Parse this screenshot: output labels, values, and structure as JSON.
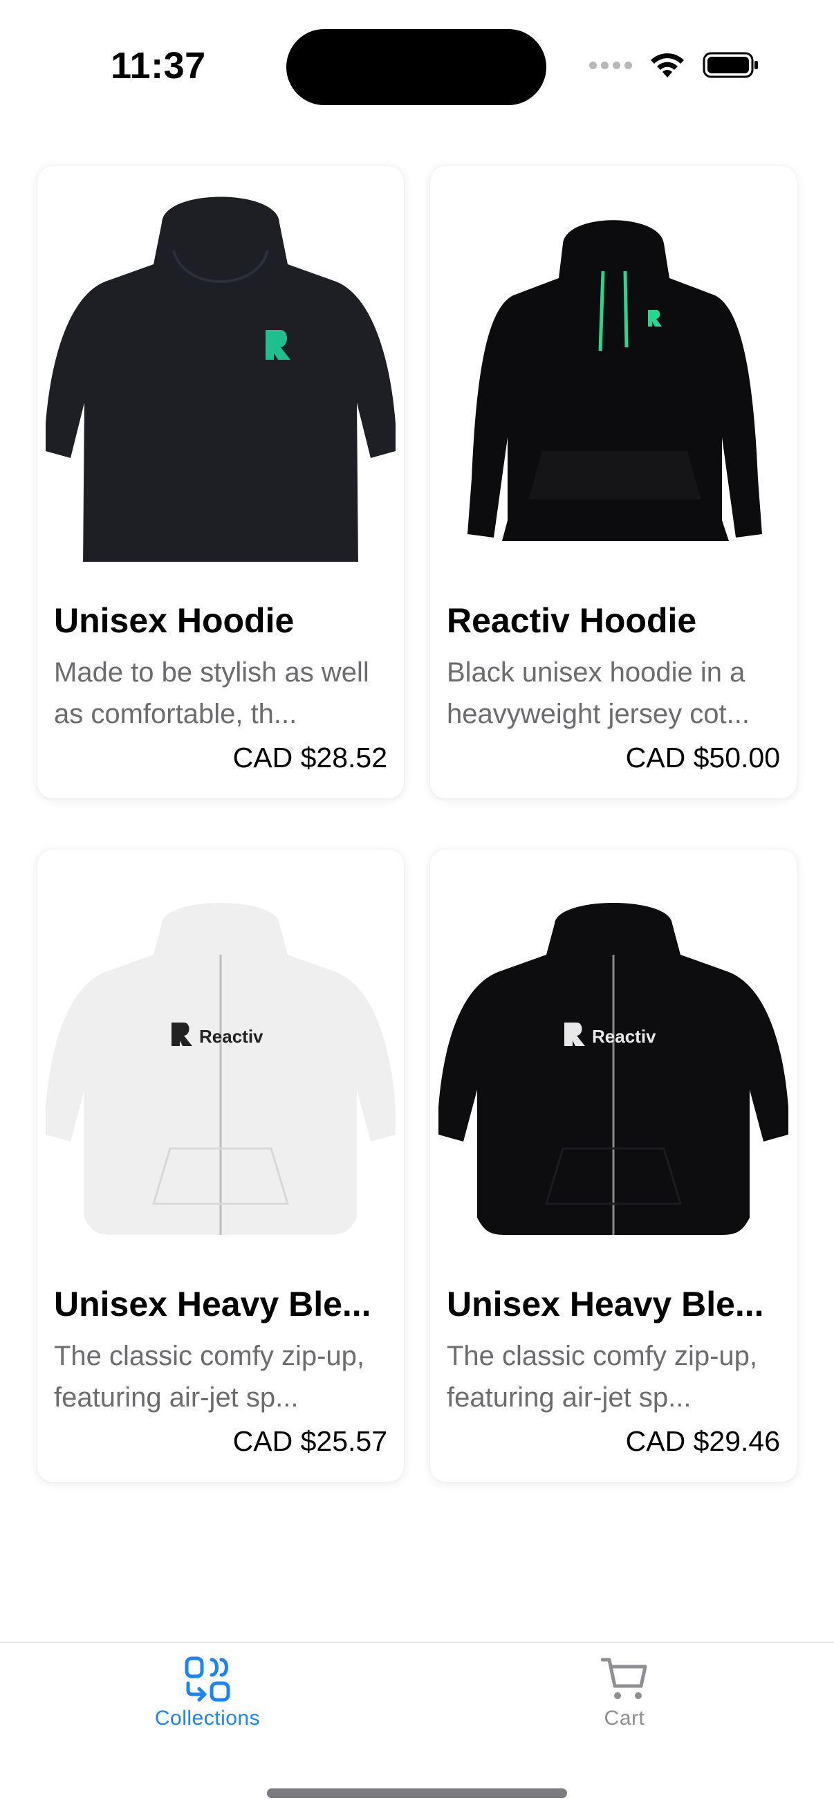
{
  "status_bar": {
    "time": "11:37",
    "icons": [
      "cellular-signal-icon",
      "wifi-icon",
      "battery-icon"
    ]
  },
  "products": [
    {
      "title": "Unisex Hoodie",
      "description": "Made to be stylish as well as comfortable, th...",
      "price": "CAD $28.52",
      "image": "hoodie-pullover-dark-navy"
    },
    {
      "title": "Reactiv Hoodie",
      "description": "Black unisex hoodie in a heavyweight jersey cot...",
      "price": "CAD $50.00",
      "image": "hoodie-pullover-black-green-drawstrings"
    },
    {
      "title": "Unisex Heavy Ble...",
      "description": "The classic comfy zip-up, featuring air-jet sp...",
      "price": "CAD $25.57",
      "image": "hoodie-zip-white",
      "image_text": "Reactiv"
    },
    {
      "title": "Unisex Heavy Ble...",
      "description": "The classic comfy zip-up, featuring air-jet sp...",
      "price": "CAD $29.46",
      "image": "hoodie-zip-black",
      "image_text": "Reactiv"
    }
  ],
  "tab_bar": {
    "collections_label": "Collections",
    "cart_label": "Cart",
    "active_color": "#1a84ff",
    "inactive_color": "#8e8e93"
  }
}
